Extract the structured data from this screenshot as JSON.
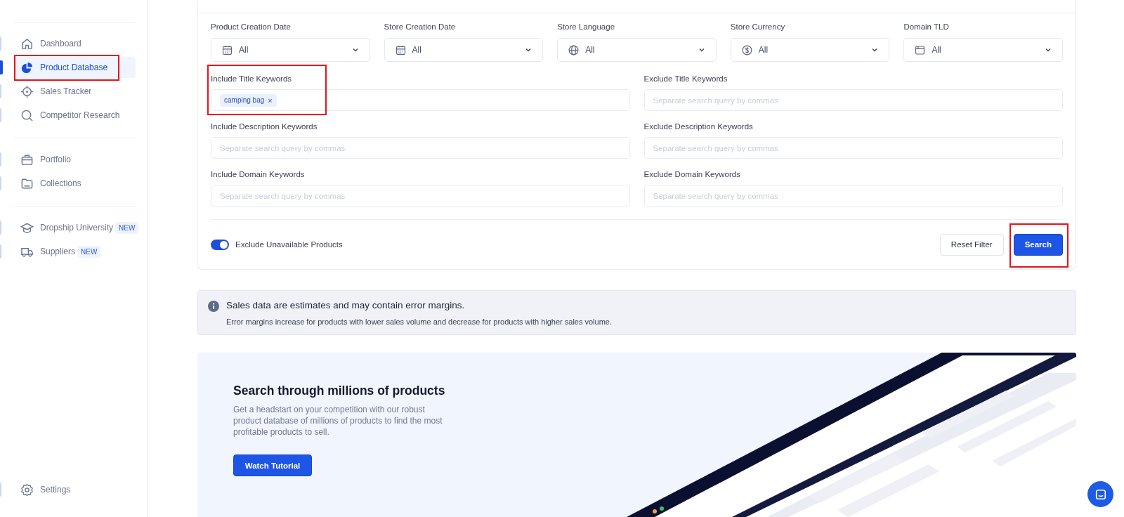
{
  "sidebar": {
    "groups": [
      [
        {
          "label": "Dashboard",
          "selected": false,
          "highlighted": false
        },
        {
          "label": "Product Database",
          "selected": true,
          "highlighted": true
        },
        {
          "label": "Sales Tracker",
          "selected": false,
          "highlighted": false
        },
        {
          "label": "Competitor Research",
          "selected": false,
          "highlighted": false
        }
      ],
      [
        {
          "label": "Portfolio",
          "selected": false,
          "highlighted": false
        },
        {
          "label": "Collections",
          "selected": false,
          "highlighted": false
        }
      ],
      [
        {
          "label": "Dropship University",
          "badge": "NEW",
          "selected": false,
          "highlighted": false
        },
        {
          "label": "Suppliers",
          "badge": "NEW",
          "selected": false,
          "highlighted": false
        }
      ]
    ],
    "footer": [
      {
        "label": "Settings",
        "selected": false,
        "highlighted": false
      }
    ]
  },
  "filters": {
    "selects": [
      {
        "label": "Product Creation Date",
        "value": "All"
      },
      {
        "label": "Store Creation Date",
        "value": "All"
      },
      {
        "label": "Store Language",
        "value": "All"
      },
      {
        "label": "Store Currency",
        "value": "All"
      },
      {
        "label": "Domain TLD",
        "value": "All"
      }
    ],
    "keyword_fields": [
      {
        "label": "Include Title Keywords",
        "tags": [
          {
            "text": "camping bag",
            "remove": "×"
          }
        ],
        "highlighted": true
      },
      {
        "label": "Exclude Title Keywords",
        "placeholder": "Separate search query by commas",
        "highlighted": false
      },
      {
        "label": "Include Description Keywords",
        "placeholder": "Separate search query by commas",
        "highlighted": false
      },
      {
        "label": "Exclude Description Keywords",
        "placeholder": "Separate search query by commas",
        "highlighted": false
      },
      {
        "label": "Include Domain Keywords",
        "placeholder": "Separate search query by commas",
        "highlighted": false
      },
      {
        "label": "Exclude Domain Keywords",
        "placeholder": "Separate search query by commas",
        "highlighted": false
      }
    ],
    "toggle": {
      "label": "Exclude Unavailable Products",
      "on": true
    },
    "buttons": [
      {
        "label": "Reset Filter",
        "kind": "secondary",
        "highlighted": false
      },
      {
        "label": "Search",
        "kind": "primary",
        "highlighted": true
      }
    ]
  },
  "notice": {
    "title": "Sales data are estimates and may contain error margins.",
    "text": "Error margins increase for products with lower sales volume and decrease for products with higher sales volume."
  },
  "promo": {
    "title": "Search through millions of products",
    "text": "Get a headstart on your competition with our robust product database of millions of products to find the most profitable products to sell.",
    "button": "Watch Tutorial"
  }
}
